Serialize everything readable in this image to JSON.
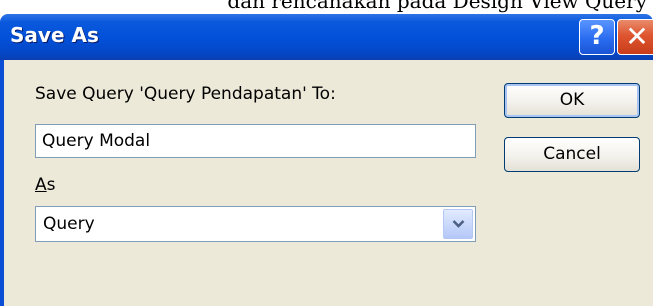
{
  "top_caption": "dan rencanakan pada Design View Query",
  "dialog": {
    "title": "Save As",
    "help_symbol": "?",
    "close_symbol": "✕",
    "save_to_label": "Save Query 'Query Pendapatan' To:",
    "name_value": "Query Modal",
    "as_label_accel": "A",
    "as_label_rest": "s",
    "as_value": "Query",
    "ok_label": "OK",
    "cancel_label": "Cancel"
  },
  "colors": {
    "titlebar": "#0250d8",
    "client_bg": "#ece9d8",
    "close_button": "#de5530"
  },
  "icons": {
    "help": "help-icon",
    "close": "close-icon",
    "dropdown": "chevron-down-icon"
  }
}
